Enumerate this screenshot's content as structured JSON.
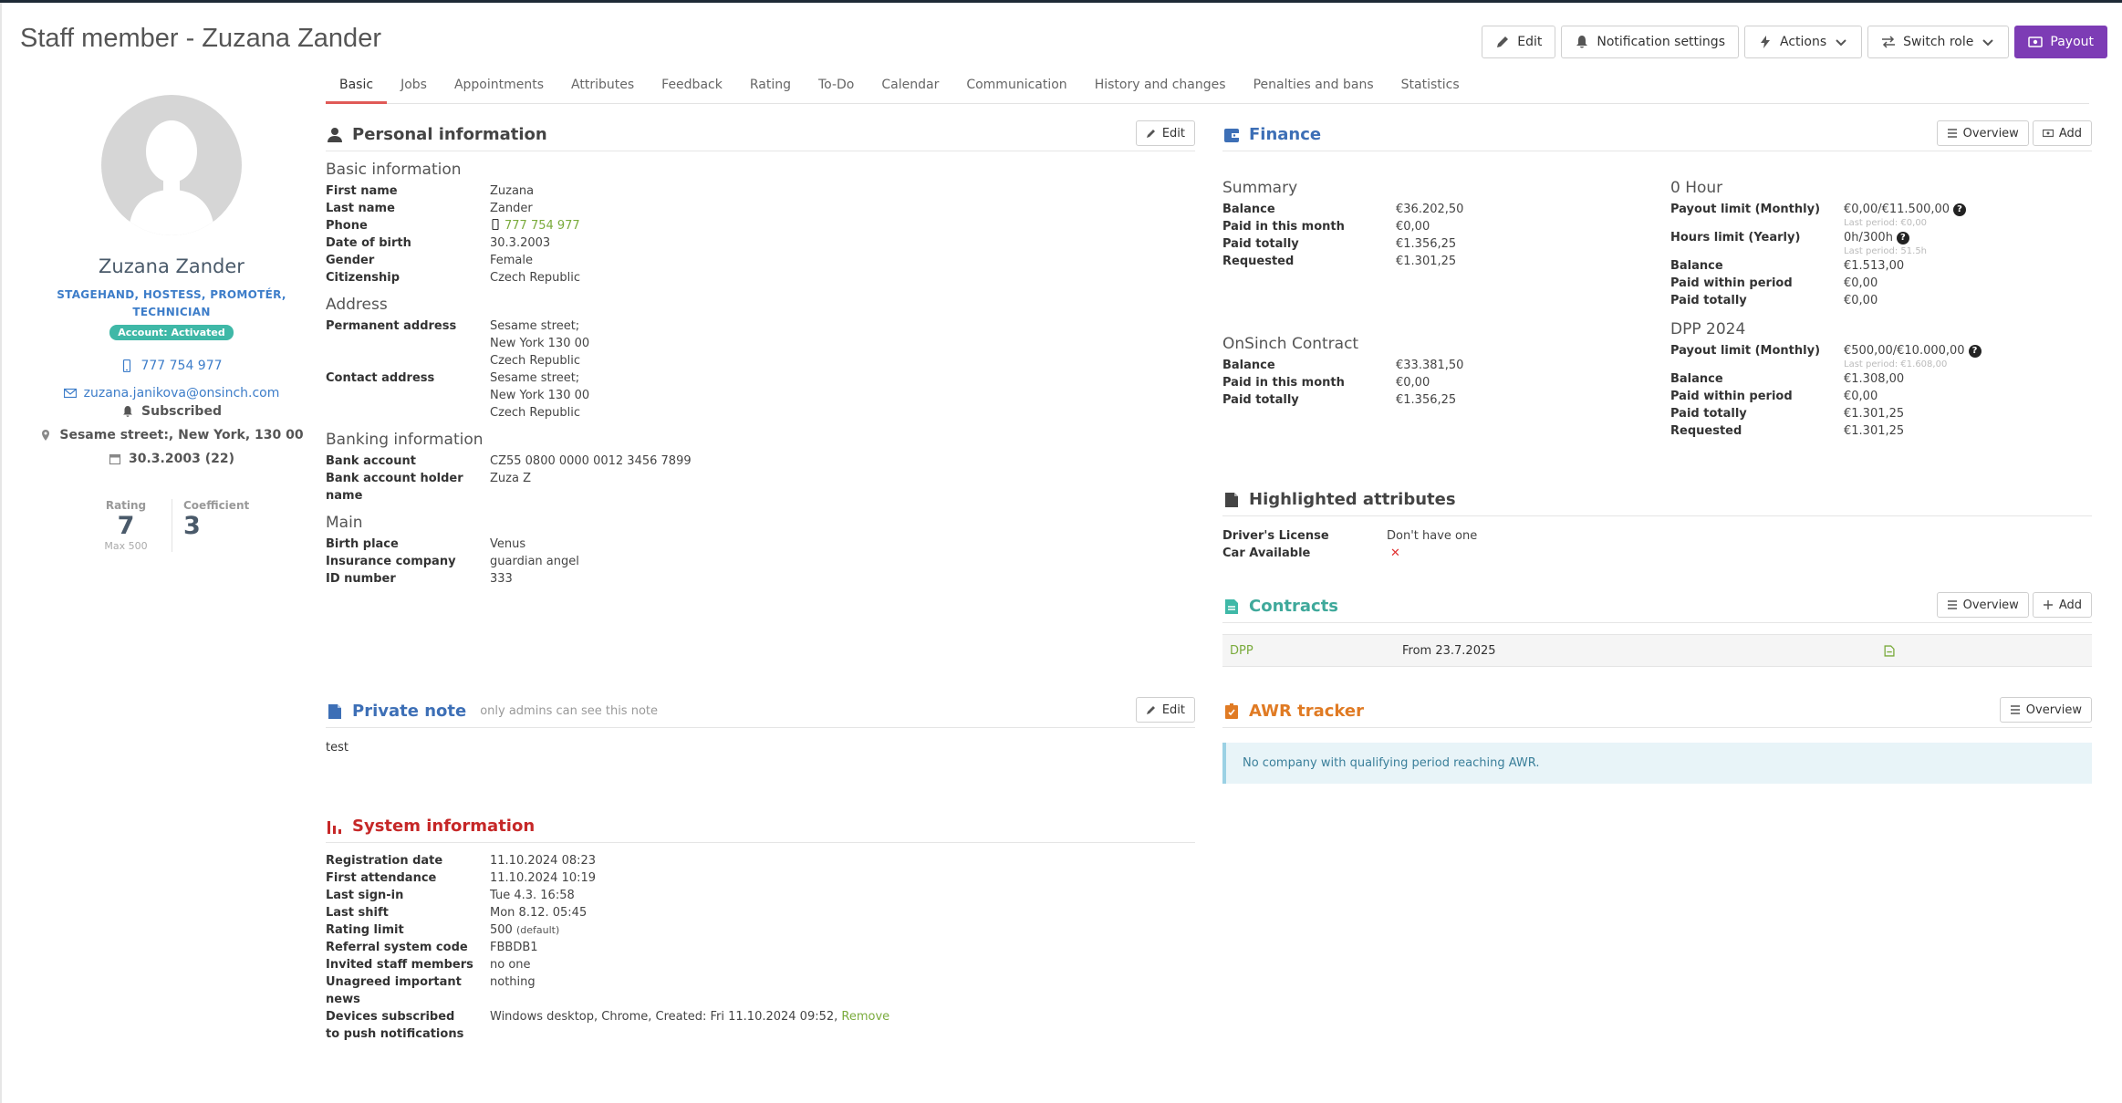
{
  "page_title": "Staff member - Zuzana Zander",
  "toolbar": {
    "edit": "Edit",
    "notifications": "Notification settings",
    "actions": "Actions",
    "switch_role": "Switch role",
    "payout": "Payout"
  },
  "tabs": [
    "Basic",
    "Jobs",
    "Appointments",
    "Attributes",
    "Feedback",
    "Rating",
    "To-Do",
    "Calendar",
    "Communication",
    "History and changes",
    "Penalties and bans",
    "Statistics"
  ],
  "profile": {
    "name": "Zuzana Zander",
    "roles": "STAGEHAND, HOSTESS, PROMOTÉR, TECHNICIAN",
    "account_status": "Account: Activated",
    "phone": "777 754 977",
    "email": "zuzana.janikova@onsinch.com",
    "subscribed": "Subscribed",
    "address": "Sesame street:, New York, 130 00",
    "birth": "30.3.2003 (22)",
    "rating_label": "Rating",
    "rating_value": "7",
    "rating_max": "Max 500",
    "coefficient_label": "Coefficient",
    "coefficient_value": "3"
  },
  "personal": {
    "title": "Personal information",
    "edit": "Edit",
    "basic_title": "Basic information",
    "basic": [
      {
        "k": "First name",
        "v": "Zuzana"
      },
      {
        "k": "Last name",
        "v": "Zander"
      },
      {
        "k": "Phone",
        "v": "777 754 977"
      },
      {
        "k": "Date of birth",
        "v": "30.3.2003"
      },
      {
        "k": "Gender",
        "v": "Female"
      },
      {
        "k": "Citizenship",
        "v": "Czech Republic"
      }
    ],
    "address_title": "Address",
    "permanent_label": "Permanent address",
    "permanent": [
      "Sesame street;",
      "New York 130 00",
      "Czech Republic"
    ],
    "contact_label": "Contact address",
    "contact": [
      "Sesame street;",
      "New York 130 00",
      "Czech Republic"
    ],
    "banking_title": "Banking information",
    "bank_account_label": "Bank account",
    "bank_account": "CZ55 0800 0000 0012 3456 7899",
    "holder_label": "Bank account holder name",
    "holder": "Zuza Z",
    "main_title": "Main",
    "main": [
      {
        "k": "Birth place",
        "v": "Venus"
      },
      {
        "k": "Insurance company",
        "v": "guardian angel"
      },
      {
        "k": "ID number",
        "v": "333"
      }
    ]
  },
  "private_note": {
    "title": "Private note",
    "subtitle": "only admins can see this note",
    "edit": "Edit",
    "text": "test"
  },
  "system": {
    "title": "System information",
    "rows": [
      {
        "k": "Registration date",
        "v": "11.10.2024 08:23"
      },
      {
        "k": "First attendance",
        "v": "11.10.2024 10:19"
      },
      {
        "k": "Last sign-in",
        "v": "Tue 4.3. 16:58"
      },
      {
        "k": "Last shift",
        "v": "Mon 8.12. 05:45"
      }
    ],
    "rating_limit_label": "Rating limit",
    "rating_limit": "500",
    "rating_limit_note": "(default)",
    "referral_label": "Referral system code",
    "referral": "FBBDB1",
    "invited_label": "Invited staff members",
    "invited": "no one",
    "unagreed_label": "Unagreed important news",
    "unagreed": "nothing",
    "devices_label": "Devices subscribed to push notifications",
    "devices": "Windows desktop, Chrome, Created: Fri 11.10.2024 09:52,",
    "remove": "Remove"
  },
  "finance": {
    "title": "Finance",
    "overview": "Overview",
    "add": "Add",
    "summary_title": "Summary",
    "summary": [
      {
        "k": "Balance",
        "v": "€36.202,50"
      },
      {
        "k": "Paid in this month",
        "v": "€0,00"
      },
      {
        "k": "Paid totally",
        "v": "€1.356,25"
      },
      {
        "k": "Requested",
        "v": "€1.301,25"
      }
    ],
    "onsinch_title": "OnSinch Contract",
    "onsinch": [
      {
        "k": "Balance",
        "v": "€33.381,50"
      },
      {
        "k": "Paid in this month",
        "v": "€0,00"
      },
      {
        "k": "Paid totally",
        "v": "€1.356,25"
      }
    ],
    "zero_title": "0 Hour",
    "zero_payout_label": "Payout limit (Monthly)",
    "zero_payout": "€0,00/€11.500,00",
    "zero_payout_hint": "Last period: €0,00",
    "zero_hours_label": "Hours limit (Yearly)",
    "zero_hours": "0h/300h",
    "zero_hours_hint": "Last period: 51.5h",
    "zero_rows": [
      {
        "k": "Balance",
        "v": "€1.513,00"
      },
      {
        "k": "Paid within period",
        "v": "€0,00"
      },
      {
        "k": "Paid totally",
        "v": "€0,00"
      }
    ],
    "dpp_title": "DPP 2024",
    "dpp_payout_label": "Payout limit (Monthly)",
    "dpp_payout": "€500,00/€10.000,00",
    "dpp_payout_hint": "Last period: €1.608,00",
    "dpp_rows": [
      {
        "k": "Balance",
        "v": "€1.308,00"
      },
      {
        "k": "Paid within period",
        "v": "€0,00"
      },
      {
        "k": "Paid totally",
        "v": "€1.301,25"
      },
      {
        "k": "Requested",
        "v": "€1.301,25"
      }
    ]
  },
  "highlighted": {
    "title": "Highlighted attributes",
    "license_label": "Driver's License",
    "license": "Don't have one",
    "car_label": "Car Available",
    "car": "✕"
  },
  "contracts": {
    "title": "Contracts",
    "overview": "Overview",
    "add": "Add",
    "type": "DPP",
    "from": "From 23.7.2025"
  },
  "awr": {
    "title": "AWR tracker",
    "overview": "Overview",
    "message": "No company with qualifying period reaching AWR."
  },
  "colors": {
    "accent_purple": "#7d3cb5",
    "finance_blue": "#3d6fb6",
    "contracts_teal": "#3fb8a7",
    "awr_orange": "#e07b24",
    "system_red": "#c62828",
    "tab_active": "#e05a57",
    "link_green": "#7aab3c"
  }
}
